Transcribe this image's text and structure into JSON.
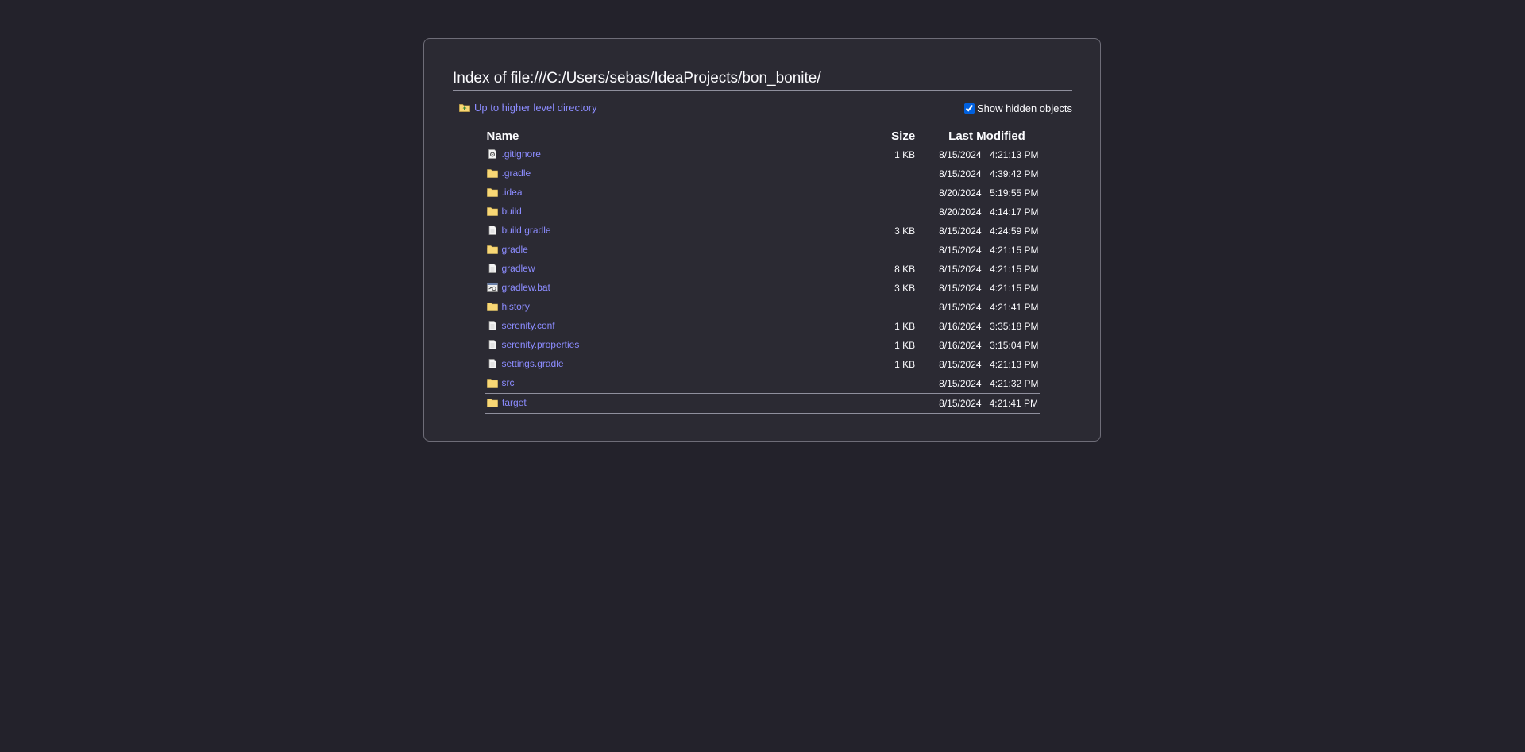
{
  "page": {
    "title": "Index of file:///C:/Users/sebas/IdeaProjects/bon_bonite/",
    "up_label": "Up to higher level directory",
    "hidden_label": "Show hidden objects",
    "hidden_checked": true
  },
  "table": {
    "headers": {
      "name": "Name",
      "size": "Size",
      "modified": "Last Modified"
    },
    "rows": [
      {
        "name": ".gitignore",
        "icon": "settings-file-icon",
        "size": "1 KB",
        "date": "8/15/2024",
        "time": "4:21:13 PM"
      },
      {
        "name": ".gradle",
        "icon": "folder-icon",
        "size": "",
        "date": "8/15/2024",
        "time": "4:39:42 PM"
      },
      {
        "name": ".idea",
        "icon": "folder-icon",
        "size": "",
        "date": "8/20/2024",
        "time": "5:19:55 PM"
      },
      {
        "name": "build",
        "icon": "folder-icon",
        "size": "",
        "date": "8/20/2024",
        "time": "4:14:17 PM"
      },
      {
        "name": "build.gradle",
        "icon": "file-icon",
        "size": "3 KB",
        "date": "8/15/2024",
        "time": "4:24:59 PM"
      },
      {
        "name": "gradle",
        "icon": "folder-icon",
        "size": "",
        "date": "8/15/2024",
        "time": "4:21:15 PM"
      },
      {
        "name": "gradlew",
        "icon": "file-icon",
        "size": "8 KB",
        "date": "8/15/2024",
        "time": "4:21:15 PM"
      },
      {
        "name": "gradlew.bat",
        "icon": "batch-file-icon",
        "size": "3 KB",
        "date": "8/15/2024",
        "time": "4:21:15 PM"
      },
      {
        "name": "history",
        "icon": "folder-icon",
        "size": "",
        "date": "8/15/2024",
        "time": "4:21:41 PM"
      },
      {
        "name": "serenity.conf",
        "icon": "file-icon",
        "size": "1 KB",
        "date": "8/16/2024",
        "time": "3:35:18 PM"
      },
      {
        "name": "serenity.properties",
        "icon": "file-icon",
        "size": "1 KB",
        "date": "8/16/2024",
        "time": "3:15:04 PM"
      },
      {
        "name": "settings.gradle",
        "icon": "file-icon",
        "size": "1 KB",
        "date": "8/15/2024",
        "time": "4:21:13 PM"
      },
      {
        "name": "src",
        "icon": "folder-icon",
        "size": "",
        "date": "8/15/2024",
        "time": "4:21:32 PM"
      },
      {
        "name": "target",
        "icon": "folder-icon",
        "size": "",
        "date": "8/15/2024",
        "time": "4:21:41 PM",
        "focused": true
      }
    ]
  },
  "colors": {
    "background": "#23222b",
    "panel": "#2b2a33",
    "link": "#8c8cff",
    "folder": "#f8d775"
  }
}
